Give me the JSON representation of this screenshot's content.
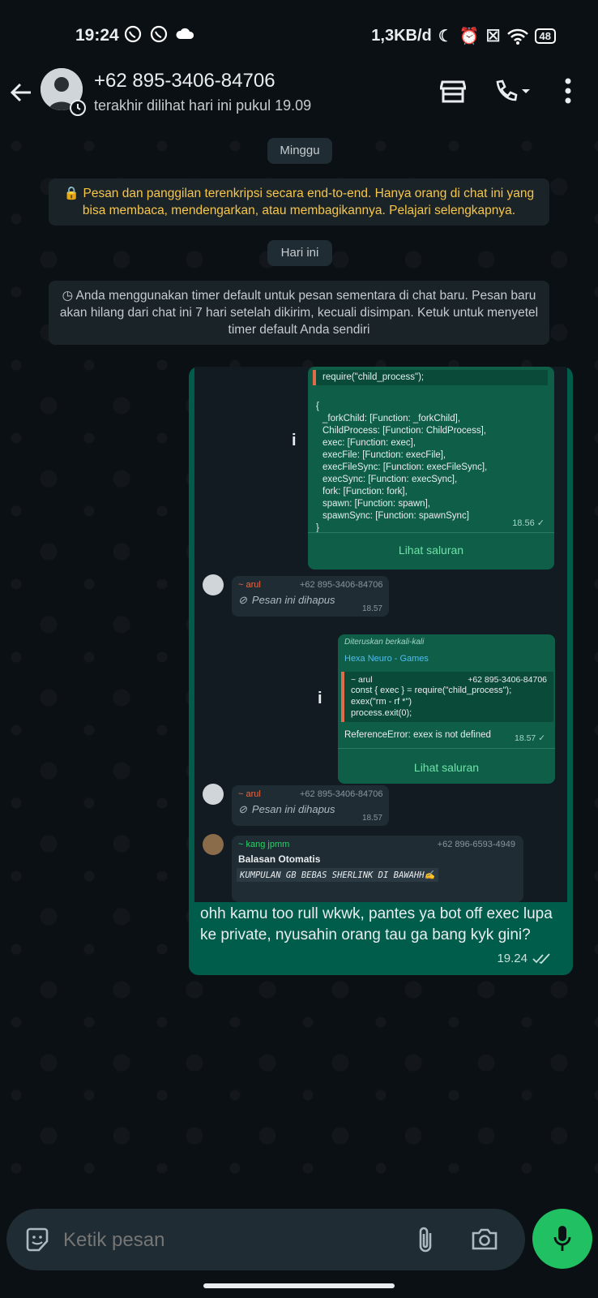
{
  "status_bar": {
    "time": "19:24",
    "network": "1,3KB/d",
    "battery": "48"
  },
  "header": {
    "contact_name": "+62 895-3406-84706",
    "last_seen": "terakhir dilihat hari ini pukul 19.09"
  },
  "chat": {
    "date_pill_1": "Minggu",
    "encryption_notice": "🔒 Pesan dan panggilan terenkripsi secara end-to-end. Hanya orang di chat ini yang bisa membaca, mendengarkan, atau membagikannya. Pelajari selengkapnya.",
    "date_pill_2": "Hari ini",
    "timer_notice": "◷ Anda menggunakan timer default untuk pesan sementara di chat baru. Pesan baru akan hilang dari chat ini 7 hari setelah dikirim, kecuali disimpan. Ketuk untuk menyetel timer default Anda sendiri"
  },
  "screenshot": {
    "code1_top": "require(\"child_process\");",
    "code1_lines": [
      "{",
      "  _forkChild: [Function: _forkChild],",
      "  ChildProcess: [Function: ChildProcess],",
      "  exec: [Function: exec],",
      "  execFile: [Function: execFile],",
      "  execFileSync: [Function: execFileSync],",
      "  execSync: [Function: execSync],",
      "  fork: [Function: fork],",
      "  spawn: [Function: spawn],",
      "  spawnSync: [Function: spawnSync]",
      "}"
    ],
    "code1_time": "18.56 ✓",
    "lihat_saluran": "Lihat saluran",
    "deleted_sender": "~ arul",
    "deleted_number": "+62 895-3406-84706",
    "deleted_text": "Pesan ini dihapus",
    "deleted_time": "18.57",
    "forwarded_label": "Diteruskan berkali-kali",
    "channel_name": "Hexa Neuro - Games",
    "quote_sender": "~ arul",
    "quote_number": "+62 895-3406-84706",
    "quote_lines": [
      "const { exec } = require(\"child_process\");",
      "exex(\"rm - rf *\")",
      "process.exit(0);"
    ],
    "error_text": "ReferenceError: exex is not defined",
    "error_time": "18.57 ✓",
    "auto_sender": "~ kang jpmm",
    "auto_number": "+62 896-6593-4949",
    "auto_title": "Balasan Otomatis",
    "auto_text": "KUMPULAN GB BEBAS SHERLINK DI BAWAHH✍️"
  },
  "message": {
    "text": "ohh kamu too rull wkwk, pantes ya bot off exec lupa ke private, nyusahin orang tau ga bang kyk gini?",
    "time": "19.24"
  },
  "composer": {
    "placeholder": "Ketik pesan"
  }
}
